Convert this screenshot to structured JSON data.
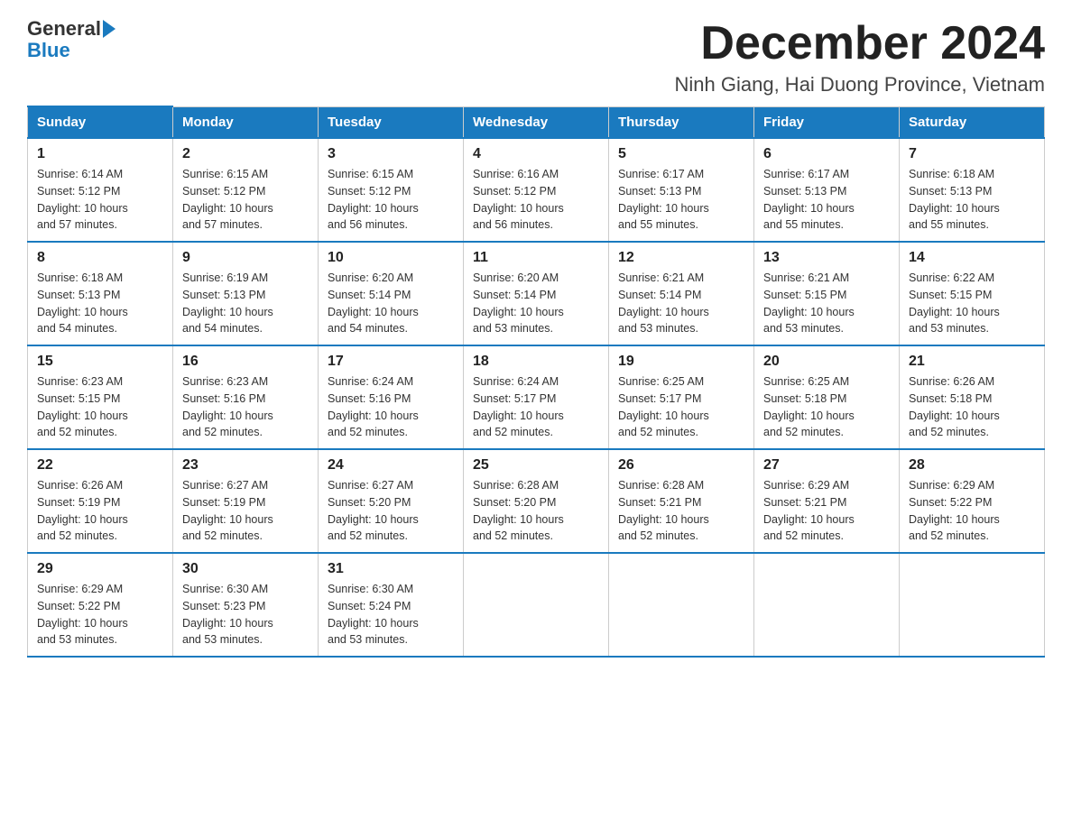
{
  "header": {
    "logo_general": "General",
    "logo_blue": "Blue",
    "month_title": "December 2024",
    "location": "Ninh Giang, Hai Duong Province, Vietnam"
  },
  "weekdays": [
    "Sunday",
    "Monday",
    "Tuesday",
    "Wednesday",
    "Thursday",
    "Friday",
    "Saturday"
  ],
  "weeks": [
    [
      {
        "day": "1",
        "sunrise": "6:14 AM",
        "sunset": "5:12 PM",
        "daylight": "10 hours and 57 minutes."
      },
      {
        "day": "2",
        "sunrise": "6:15 AM",
        "sunset": "5:12 PM",
        "daylight": "10 hours and 57 minutes."
      },
      {
        "day": "3",
        "sunrise": "6:15 AM",
        "sunset": "5:12 PM",
        "daylight": "10 hours and 56 minutes."
      },
      {
        "day": "4",
        "sunrise": "6:16 AM",
        "sunset": "5:12 PM",
        "daylight": "10 hours and 56 minutes."
      },
      {
        "day": "5",
        "sunrise": "6:17 AM",
        "sunset": "5:13 PM",
        "daylight": "10 hours and 55 minutes."
      },
      {
        "day": "6",
        "sunrise": "6:17 AM",
        "sunset": "5:13 PM",
        "daylight": "10 hours and 55 minutes."
      },
      {
        "day": "7",
        "sunrise": "6:18 AM",
        "sunset": "5:13 PM",
        "daylight": "10 hours and 55 minutes."
      }
    ],
    [
      {
        "day": "8",
        "sunrise": "6:18 AM",
        "sunset": "5:13 PM",
        "daylight": "10 hours and 54 minutes."
      },
      {
        "day": "9",
        "sunrise": "6:19 AM",
        "sunset": "5:13 PM",
        "daylight": "10 hours and 54 minutes."
      },
      {
        "day": "10",
        "sunrise": "6:20 AM",
        "sunset": "5:14 PM",
        "daylight": "10 hours and 54 minutes."
      },
      {
        "day": "11",
        "sunrise": "6:20 AM",
        "sunset": "5:14 PM",
        "daylight": "10 hours and 53 minutes."
      },
      {
        "day": "12",
        "sunrise": "6:21 AM",
        "sunset": "5:14 PM",
        "daylight": "10 hours and 53 minutes."
      },
      {
        "day": "13",
        "sunrise": "6:21 AM",
        "sunset": "5:15 PM",
        "daylight": "10 hours and 53 minutes."
      },
      {
        "day": "14",
        "sunrise": "6:22 AM",
        "sunset": "5:15 PM",
        "daylight": "10 hours and 53 minutes."
      }
    ],
    [
      {
        "day": "15",
        "sunrise": "6:23 AM",
        "sunset": "5:15 PM",
        "daylight": "10 hours and 52 minutes."
      },
      {
        "day": "16",
        "sunrise": "6:23 AM",
        "sunset": "5:16 PM",
        "daylight": "10 hours and 52 minutes."
      },
      {
        "day": "17",
        "sunrise": "6:24 AM",
        "sunset": "5:16 PM",
        "daylight": "10 hours and 52 minutes."
      },
      {
        "day": "18",
        "sunrise": "6:24 AM",
        "sunset": "5:17 PM",
        "daylight": "10 hours and 52 minutes."
      },
      {
        "day": "19",
        "sunrise": "6:25 AM",
        "sunset": "5:17 PM",
        "daylight": "10 hours and 52 minutes."
      },
      {
        "day": "20",
        "sunrise": "6:25 AM",
        "sunset": "5:18 PM",
        "daylight": "10 hours and 52 minutes."
      },
      {
        "day": "21",
        "sunrise": "6:26 AM",
        "sunset": "5:18 PM",
        "daylight": "10 hours and 52 minutes."
      }
    ],
    [
      {
        "day": "22",
        "sunrise": "6:26 AM",
        "sunset": "5:19 PM",
        "daylight": "10 hours and 52 minutes."
      },
      {
        "day": "23",
        "sunrise": "6:27 AM",
        "sunset": "5:19 PM",
        "daylight": "10 hours and 52 minutes."
      },
      {
        "day": "24",
        "sunrise": "6:27 AM",
        "sunset": "5:20 PM",
        "daylight": "10 hours and 52 minutes."
      },
      {
        "day": "25",
        "sunrise": "6:28 AM",
        "sunset": "5:20 PM",
        "daylight": "10 hours and 52 minutes."
      },
      {
        "day": "26",
        "sunrise": "6:28 AM",
        "sunset": "5:21 PM",
        "daylight": "10 hours and 52 minutes."
      },
      {
        "day": "27",
        "sunrise": "6:29 AM",
        "sunset": "5:21 PM",
        "daylight": "10 hours and 52 minutes."
      },
      {
        "day": "28",
        "sunrise": "6:29 AM",
        "sunset": "5:22 PM",
        "daylight": "10 hours and 52 minutes."
      }
    ],
    [
      {
        "day": "29",
        "sunrise": "6:29 AM",
        "sunset": "5:22 PM",
        "daylight": "10 hours and 53 minutes."
      },
      {
        "day": "30",
        "sunrise": "6:30 AM",
        "sunset": "5:23 PM",
        "daylight": "10 hours and 53 minutes."
      },
      {
        "day": "31",
        "sunrise": "6:30 AM",
        "sunset": "5:24 PM",
        "daylight": "10 hours and 53 minutes."
      },
      null,
      null,
      null,
      null
    ]
  ],
  "labels": {
    "sunrise": "Sunrise:",
    "sunset": "Sunset:",
    "daylight": "Daylight:"
  }
}
